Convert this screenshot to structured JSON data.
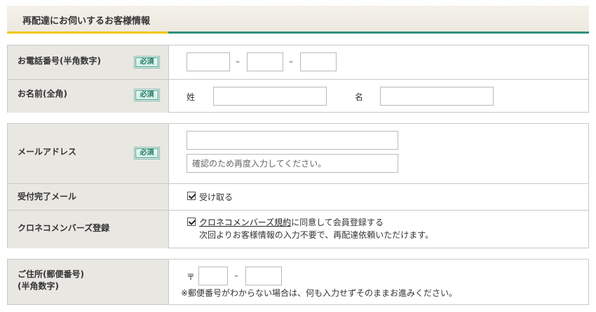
{
  "section": {
    "title": "再配達にお伺いするお客様情報"
  },
  "required_badge": "必須",
  "phone": {
    "label": "お電話番号(半角数字)",
    "sep1": "–",
    "sep2": "–"
  },
  "name": {
    "label": "お名前(全角)",
    "last_label": "姓",
    "first_label": "名"
  },
  "email": {
    "label": "メールアドレス",
    "confirm_placeholder": "確認のため再度入力してください。"
  },
  "receipt_mail": {
    "label": "受付完了メール",
    "option": "受け取る"
  },
  "kuroneko": {
    "label": "クロネコメンバーズ登録",
    "link_text": "クロネコメンバーズ規約",
    "agree_text": "に同意して会員登録する",
    "note": "次回よりお客様情報の入力不要で、再配達依頼いただけます。"
  },
  "address": {
    "label_line1": "ご住所(郵便番号)",
    "label_line2": "(半角数字)",
    "postal_mark": "〒",
    "sep": "–",
    "note": "※郵便番号がわからない場合は、何も入力せずそのままお進みください。"
  }
}
